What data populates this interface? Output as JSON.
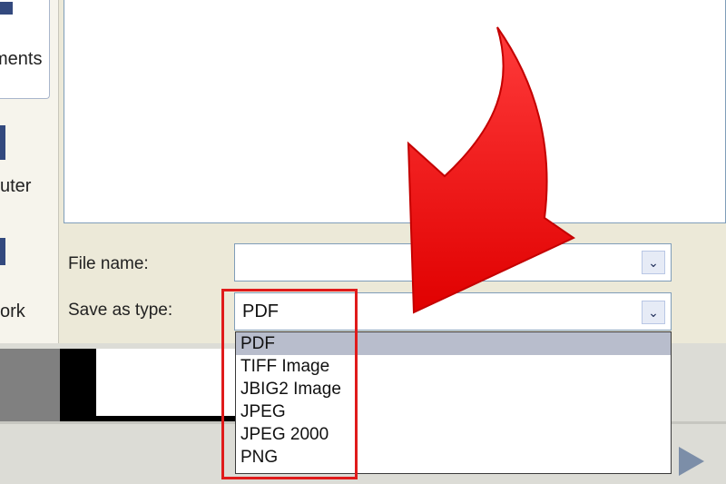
{
  "sidebar": {
    "items": [
      {
        "label": "ments",
        "icon": "documents-icon"
      },
      {
        "label": "uter",
        "icon": "computer-icon"
      },
      {
        "label": "ork",
        "icon": "network-icon"
      }
    ]
  },
  "form": {
    "file_name_label": "File name:",
    "file_name_value": "",
    "save_type_label": "Save as type:",
    "save_type_value": "PDF"
  },
  "dropdown": {
    "options": [
      "PDF",
      "TIFF Image",
      "JBIG2 Image",
      "JPEG",
      "JPEG 2000",
      "PNG"
    ],
    "selected": "PDF"
  },
  "colors": {
    "annotation_red": "#e01b1b",
    "selection": "#b8bdcc"
  }
}
